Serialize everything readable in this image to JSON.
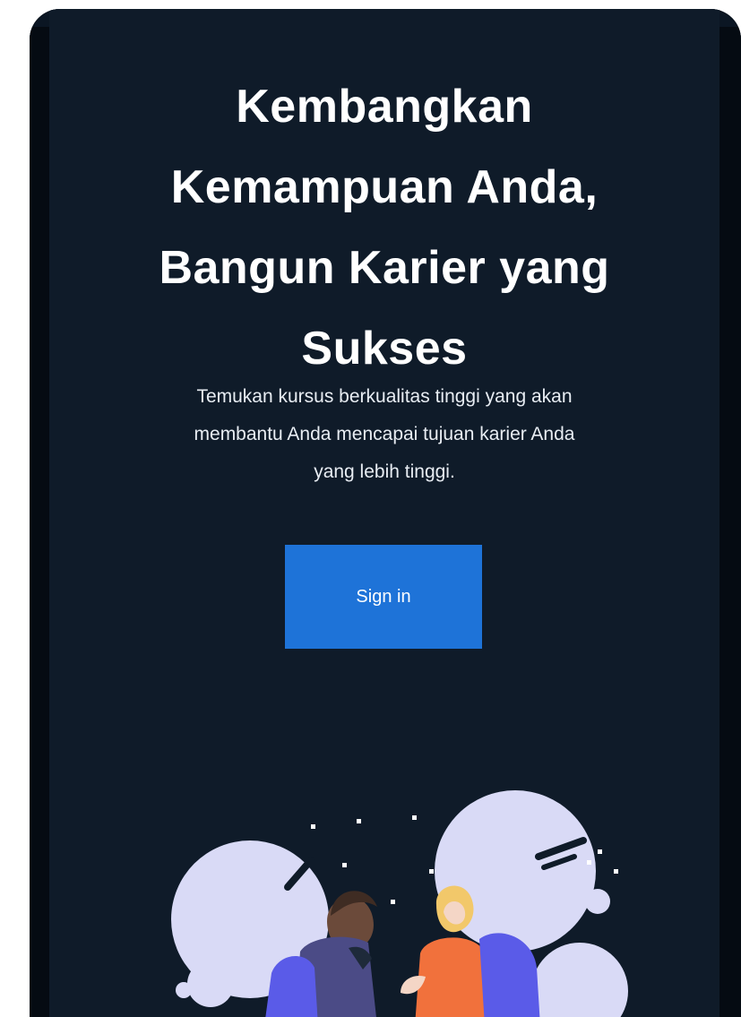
{
  "hero": {
    "title_lines": [
      "Kembangkan",
      "Kemampuan Anda,",
      "Bangun Karier yang",
      "Sukses"
    ],
    "subtitle_lines": [
      "Temukan kursus berkualitas tinggi yang akan",
      "membantu Anda mencapai tujuan karier Anda",
      "yang lebih tinggi."
    ],
    "cta_label": "Sign in"
  },
  "colors": {
    "background": "#0f1b29",
    "frame_edge": "#050b12",
    "button": "#1e73d8",
    "text": "#ffffff",
    "illustration_blob": "#d9daf6",
    "illustration_accent": "#5a5be8",
    "illustration_skin_dark": "#6b4a3a",
    "illustration_hair_blonde": "#f2c86a",
    "illustration_shirt_orange": "#f1713c"
  },
  "illustration": {
    "name": "students-illustration"
  }
}
